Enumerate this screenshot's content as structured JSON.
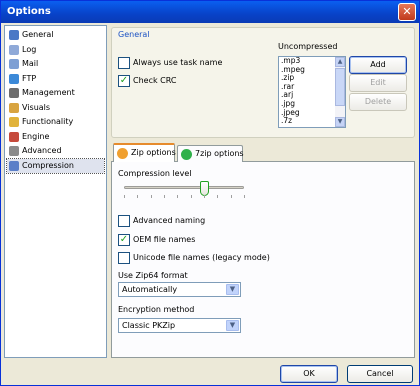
{
  "window": {
    "title": "Options",
    "close_glyph": "✕"
  },
  "sidebar": {
    "items": [
      {
        "label": "General",
        "icon": "grid-icon",
        "color": "#4a78c6"
      },
      {
        "label": "Log",
        "icon": "notepad-icon",
        "color": "#8fa9d8"
      },
      {
        "label": "Mail",
        "icon": "mail-icon",
        "color": "#7d9fd4"
      },
      {
        "label": "FTP",
        "icon": "globe-icon",
        "color": "#3c89d8"
      },
      {
        "label": "Management",
        "icon": "tools-icon",
        "color": "#6d6d6d"
      },
      {
        "label": "Visuals",
        "icon": "palette-icon",
        "color": "#d8a440"
      },
      {
        "label": "Functionality",
        "icon": "puzzle-icon",
        "color": "#e1b33b"
      },
      {
        "label": "Engine",
        "icon": "engine-icon",
        "color": "#c64a3c"
      },
      {
        "label": "Advanced",
        "icon": "gear-icon",
        "color": "#8b8b8b"
      },
      {
        "label": "Compression",
        "icon": "package-icon",
        "color": "#5b7fc8"
      }
    ],
    "selected": "Compression"
  },
  "general_group": {
    "title": "General",
    "always_task_name": {
      "label": "Always use task name",
      "checked": false
    },
    "check_crc": {
      "label": "Check CRC",
      "checked": true
    },
    "uncompressed_label": "Uncompressed",
    "uncompressed_list": [
      ".mp3",
      ".mpeg",
      ".zip",
      ".rar",
      ".arj",
      ".jpg",
      ".jpeg",
      ".7z"
    ],
    "add_label": "Add",
    "edit_label": "Edit",
    "delete_label": "Delete"
  },
  "tabs": [
    {
      "label": "Zip options",
      "icon": "zip-orb-icon",
      "color": "#f0a030",
      "active": true
    },
    {
      "label": "7zip options",
      "icon": "7zip-orb-icon",
      "color": "#2fb04a",
      "active": false
    }
  ],
  "zip_options": {
    "compression_level_label": "Compression level",
    "compression_level": 0.67,
    "advanced_naming": {
      "label": "Advanced naming",
      "checked": false
    },
    "oem_file_names": {
      "label": "OEM file names",
      "checked": true
    },
    "unicode_file_names": {
      "label": "Unicode file names (legacy mode)",
      "checked": false
    },
    "zip64_label": "Use Zip64 format",
    "zip64_value": "Automatically",
    "encryption_label": "Encryption method",
    "encryption_value": "Classic PKZip"
  },
  "footer": {
    "ok_label": "OK",
    "cancel_label": "Cancel"
  },
  "glyphs": {
    "check": "✓",
    "down_arrow": "▼",
    "up_arrow": "▲"
  }
}
